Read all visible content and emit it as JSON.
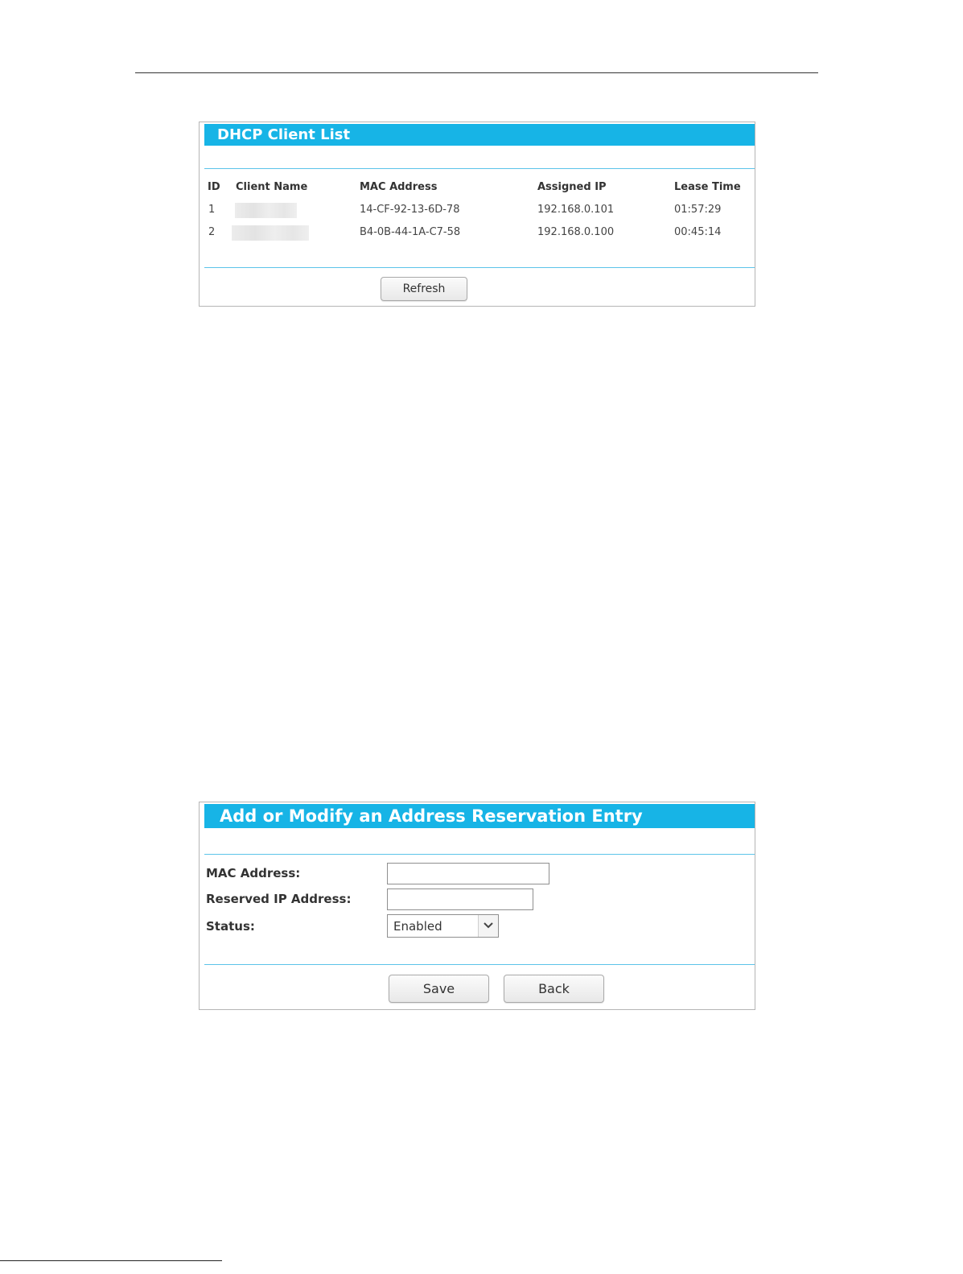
{
  "dhcp_client_list": {
    "title": "DHCP Client List",
    "columns": {
      "id": "ID",
      "client_name": "Client Name",
      "mac_address": "MAC Address",
      "assigned_ip": "Assigned IP",
      "lease_time": "Lease Time"
    },
    "rows": [
      {
        "id": "1",
        "mac_address": "14-CF-92-13-6D-78",
        "assigned_ip": "192.168.0.101",
        "lease_time": "01:57:29"
      },
      {
        "id": "2",
        "mac_address": "B4-0B-44-1A-C7-58",
        "assigned_ip": "192.168.0.100",
        "lease_time": "00:45:14"
      }
    ],
    "refresh_label": "Refresh"
  },
  "reservation_form": {
    "title": "Add or Modify an Address Reservation Entry",
    "mac_label": "MAC Address:",
    "mac_value": "",
    "ip_label": "Reserved IP Address:",
    "ip_value": "",
    "status_label": "Status:",
    "status_selected": "Enabled",
    "save_label": "Save",
    "back_label": "Back"
  },
  "colors": {
    "header_blue": "#17b4e6",
    "divider_blue": "#5cc4e9"
  }
}
